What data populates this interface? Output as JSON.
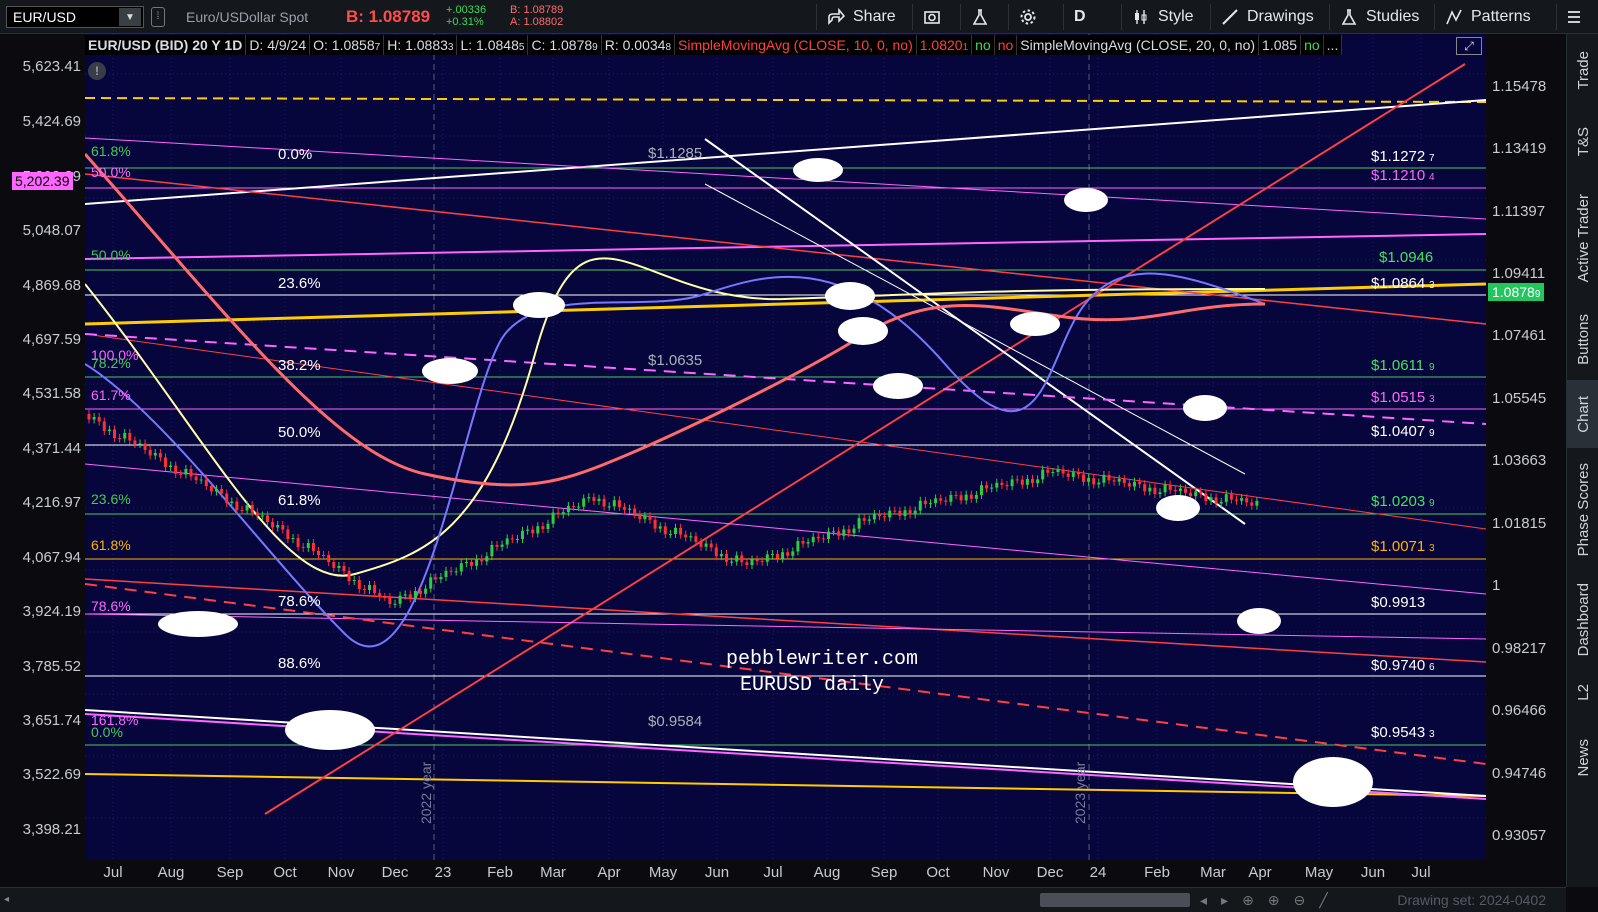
{
  "toolbar": {
    "symbol": "EUR/USD",
    "description": "Euro/USDollar Spot",
    "bid_label": "B: 1.08789",
    "change_abs": "+.00336",
    "change_pct": "+0.31%",
    "bid_small": "B: 1.08789",
    "ask_small": "A: 1.08802",
    "share": "Share",
    "period": "D",
    "style": "Style",
    "drawings": "Drawings",
    "studies": "Studies",
    "patterns": "Patterns"
  },
  "infobar": {
    "symbol": "EUR/USD (BID) 20 Y 1D",
    "date": "D: 4/9/24",
    "open": "O: 1.0858",
    "open_tail": "7",
    "high": "H: 1.0883",
    "high_tail": "3",
    "low": "L: 1.0848",
    "low_tail": "5",
    "close": "C: 1.0878",
    "close_tail": "9",
    "range": "R: 0.0034",
    "range_tail": "8",
    "sma10": "SimpleMovingAvg (CLOSE, 10, 0, no)",
    "sma10_val": "1.0820",
    "sma10_tail": "1",
    "no1": "no",
    "no2": "no",
    "sma20": "SimpleMovingAvg (CLOSE, 20, 0, no)",
    "sma20_val": "1.085",
    "no3": "no",
    "more": "..."
  },
  "left_axis": [
    "5,623.41",
    "5,424.69",
    "5,202.39",
    "5,048.07",
    "4,869.68",
    "4,697.59",
    "4,531.58",
    "4,371.44",
    "4,216.97",
    "4,067.94",
    "3,924.19",
    "3,785.52",
    "3,651.74",
    "3,522.69",
    "3,398.21"
  ],
  "right_axis": [
    "1.15478",
    "1.13419",
    "1.11397",
    "1.09411",
    "1.07461",
    "1.05545",
    "1.03663",
    "1.01815",
    "1",
    "0.98217",
    "0.96466",
    "0.94746",
    "0.93057"
  ],
  "current_price": "1.0878",
  "current_price_tail": "9",
  "left_highlight": "5,202.39",
  "time_axis": [
    "Jul",
    "Aug",
    "Sep",
    "Oct",
    "Nov",
    "Dec",
    "23",
    "Feb",
    "Mar",
    "Apr",
    "May",
    "Jun",
    "Jul",
    "Aug",
    "Sep",
    "Oct",
    "Nov",
    "Dec",
    "24",
    "Feb",
    "Mar",
    "Apr",
    "May",
    "Jun",
    "Jul"
  ],
  "fib_left": [
    {
      "text": "61.8%",
      "color": "#48c85a"
    },
    {
      "text": "50.0%",
      "color": "#ff66ff"
    },
    {
      "text": "50.0%",
      "color": "#48c85a"
    },
    {
      "text": "100.0%",
      "color": "#ff66ff"
    },
    {
      "text": "78.2%",
      "color": "#48c85a"
    },
    {
      "text": "61.7%",
      "color": "#ff66ff"
    },
    {
      "text": "23.6%",
      "color": "#48c85a"
    },
    {
      "text": "61.8%",
      "color": "#ffb300"
    },
    {
      "text": "78.6%",
      "color": "#ff66ff"
    },
    {
      "text": "161.8%",
      "color": "#ff66ff"
    },
    {
      "text": "0.0%",
      "color": "#48c85a"
    }
  ],
  "fib_white": [
    "0.0%",
    "23.6%",
    "38.2%",
    "50.0%",
    "61.8%",
    "78.6%",
    "88.6%"
  ],
  "price_tags": [
    {
      "text": "$1.1285",
      "color": "#aab0b8"
    },
    {
      "text": "$1.0635",
      "color": "#aab0b8"
    },
    {
      "text": "$0.9584",
      "color": "#aab0b8"
    }
  ],
  "right_tags": [
    {
      "text": "$1.1272",
      "tail": "7",
      "color": "#ffffff"
    },
    {
      "text": "$1.1210",
      "tail": "4",
      "color": "#ff66ff"
    },
    {
      "text": "$1.0946",
      "tail": "",
      "color": "#48e060"
    },
    {
      "text": "$1.0864",
      "tail": "3",
      "color": "#ffffff"
    },
    {
      "text": "$1.0611",
      "tail": "9",
      "color": "#48e060"
    },
    {
      "text": "$1.0515",
      "tail": "3",
      "color": "#ff66ff"
    },
    {
      "text": "$1.0407",
      "tail": "9",
      "color": "#ffffff"
    },
    {
      "text": "$1.0203",
      "tail": "9",
      "color": "#48e060"
    },
    {
      "text": "$1.0071",
      "tail": "3",
      "color": "#ffb300"
    },
    {
      "text": "$0.9913",
      "tail": "",
      "color": "#ffffff"
    },
    {
      "text": "$0.9740",
      "tail": "6",
      "color": "#ffffff"
    },
    {
      "text": "$0.9543",
      "tail": "3",
      "color": "#ffffff"
    }
  ],
  "watermark": {
    "line1": "pebblewriter.com",
    "line2": "EURUSD daily"
  },
  "year_labels": [
    "2022 year",
    "2023 year"
  ],
  "sidebar": [
    "Trade",
    "T&S",
    "Active Trader",
    "Buttons",
    "Chart",
    "Phase Scores",
    "Dashboard",
    "L2",
    "News"
  ],
  "sidebar_active": "Chart",
  "drawing_set": "Drawing set: 2024-0402",
  "colors": {
    "plot_bg": "#06063d",
    "up": "#2ecc40",
    "down": "#ff3030",
    "accent": "#22c55e"
  }
}
